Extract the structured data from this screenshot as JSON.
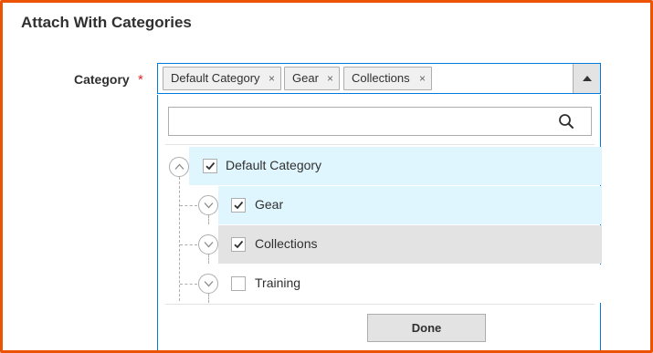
{
  "section": {
    "title": "Attach With Categories"
  },
  "field": {
    "label": "Category",
    "required_mark": "*"
  },
  "selected_chips": [
    {
      "label": "Default Category",
      "remove": "×"
    },
    {
      "label": "Gear",
      "remove": "×"
    },
    {
      "label": "Collections",
      "remove": "×"
    }
  ],
  "search": {
    "value": "",
    "placeholder": ""
  },
  "tree": [
    {
      "label": "Default Category",
      "checked": true,
      "expanded": true,
      "level": 0,
      "state": "selected"
    },
    {
      "label": "Gear",
      "checked": true,
      "expanded": false,
      "level": 1,
      "state": "selected"
    },
    {
      "label": "Collections",
      "checked": true,
      "expanded": false,
      "level": 1,
      "state": "hover"
    },
    {
      "label": "Training",
      "checked": false,
      "expanded": false,
      "level": 1,
      "state": "normal"
    }
  ],
  "actions": {
    "done_label": "Done"
  },
  "icons": {
    "toggle_open": "chevron-up-icon",
    "toggle_closed": "chevron-down-icon",
    "search": "search-icon",
    "dropdown_arrow": "triangle-up-icon",
    "check": "checkmark-icon"
  },
  "colors": {
    "frame_border": "#eb5202",
    "focus_border": "#007bdb",
    "selected_row": "#e0f6fe",
    "hover_row": "#e3e3e3",
    "required": "#e22626"
  }
}
